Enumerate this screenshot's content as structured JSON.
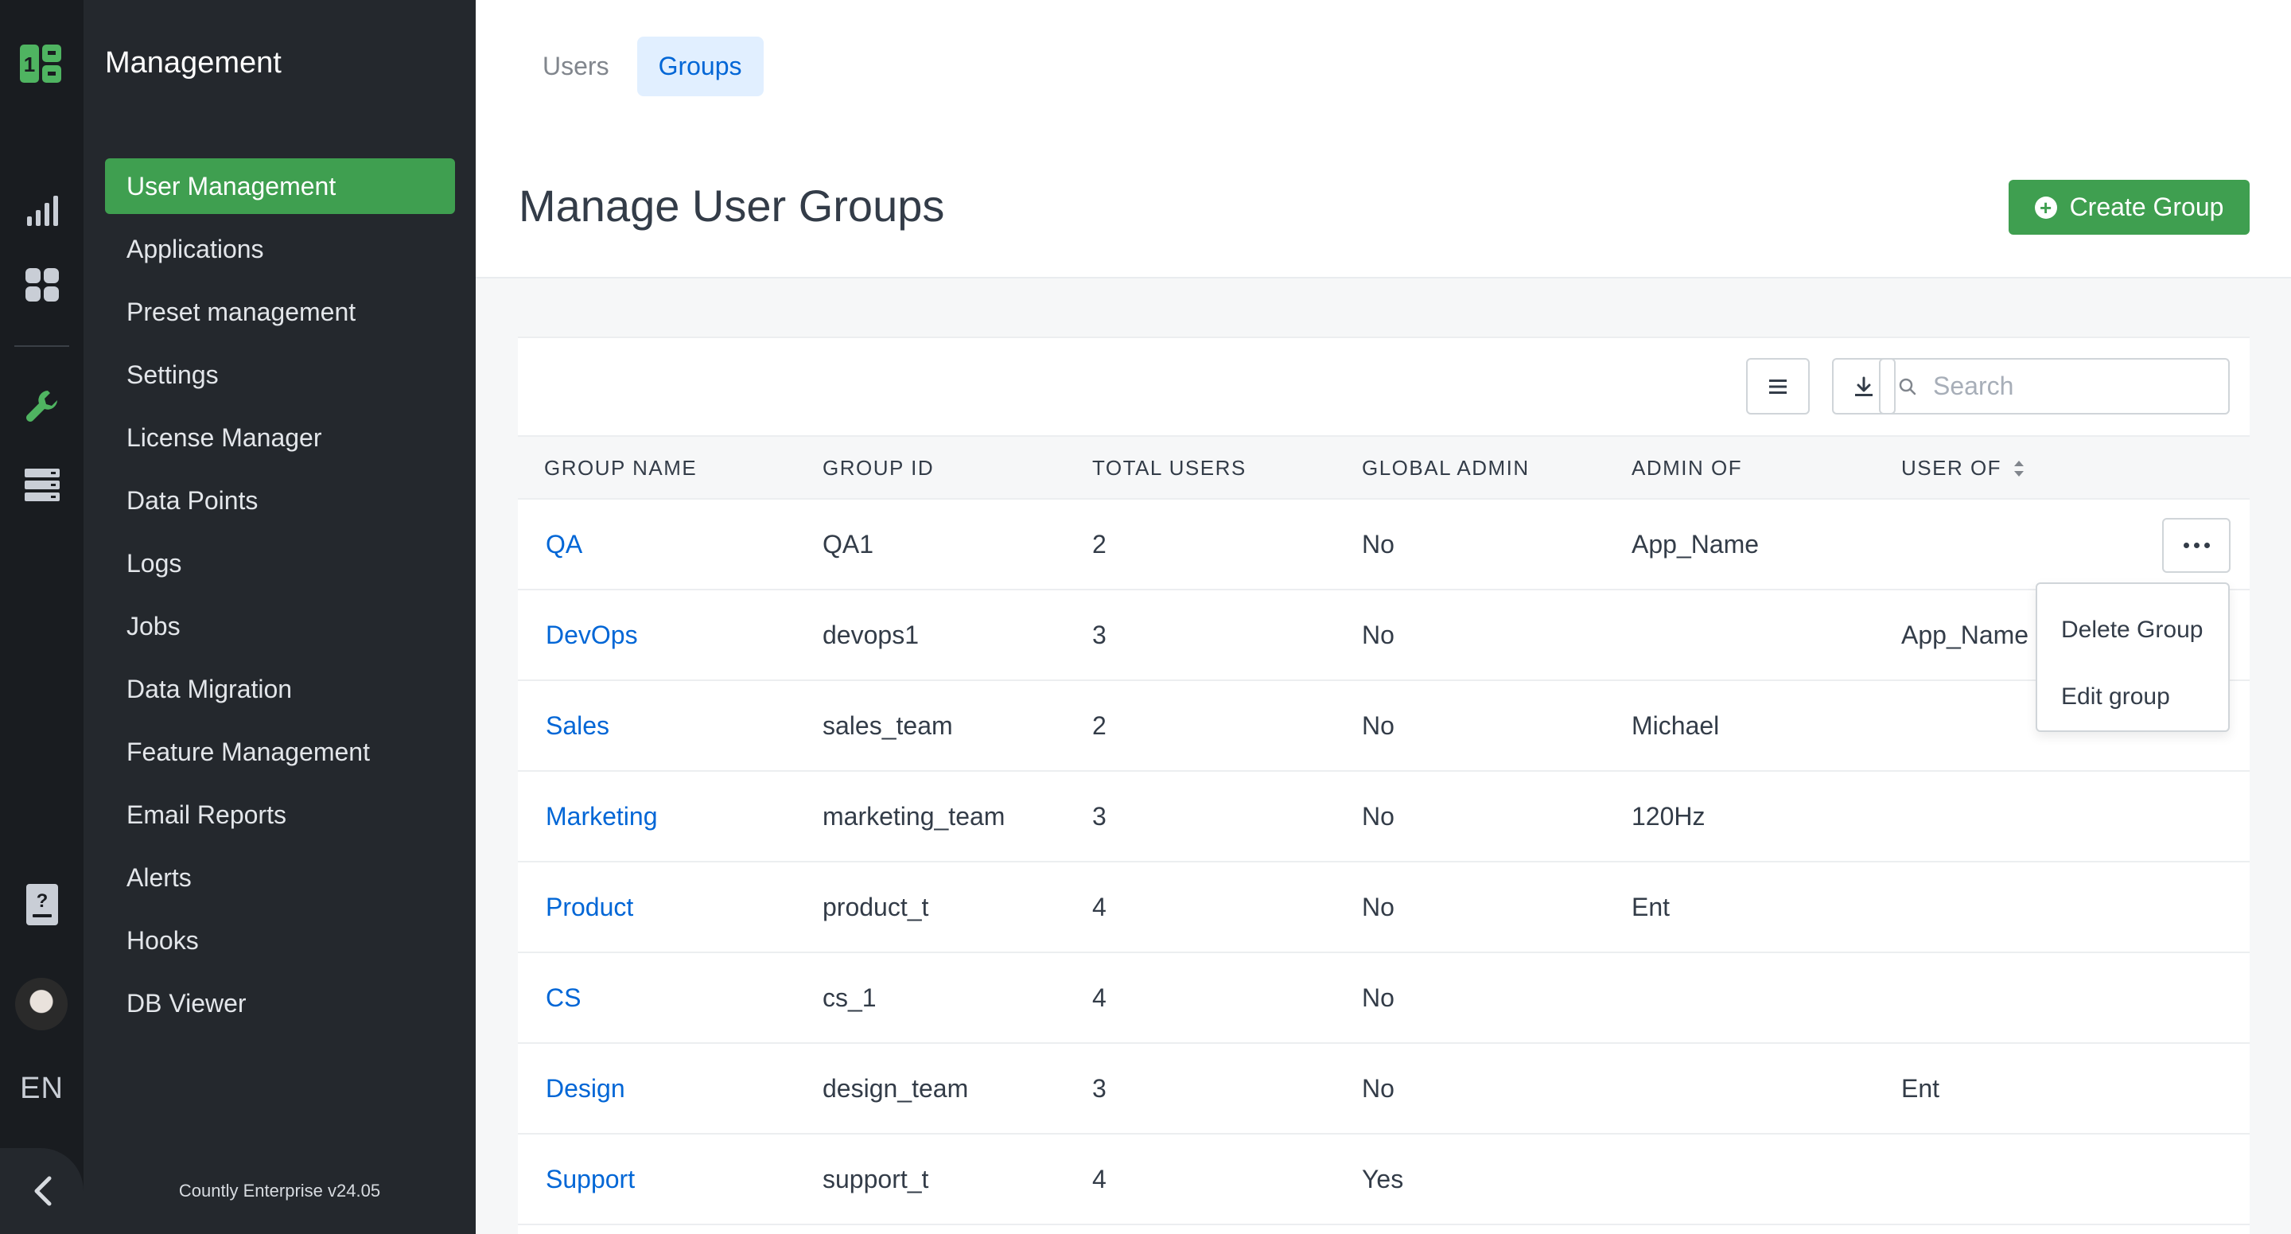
{
  "sidebar": {
    "title": "Management",
    "items": [
      {
        "label": "User Management",
        "active": true
      },
      {
        "label": "Applications"
      },
      {
        "label": "Preset management"
      },
      {
        "label": "Settings"
      },
      {
        "label": "License Manager"
      },
      {
        "label": "Data Points"
      },
      {
        "label": "Logs"
      },
      {
        "label": "Jobs"
      },
      {
        "label": "Data Migration"
      },
      {
        "label": "Feature Management"
      },
      {
        "label": "Email Reports"
      },
      {
        "label": "Alerts"
      },
      {
        "label": "Hooks"
      },
      {
        "label": "DB Viewer"
      }
    ],
    "version": "Countly Enterprise v24.05"
  },
  "rail": {
    "icons": [
      "countly-logo-icon",
      "analytics-icon",
      "dashboards-icon",
      "wrench-icon",
      "server-icon",
      "help-document-icon",
      "user-avatar",
      "collapse-chevron-icon"
    ],
    "language": "EN"
  },
  "header": {
    "tabs": [
      {
        "label": "Users",
        "active": false
      },
      {
        "label": "Groups",
        "active": true
      }
    ],
    "title": "Manage User Groups",
    "create_label": "Create Group"
  },
  "toolbar": {
    "search_placeholder": "Search"
  },
  "table": {
    "columns": [
      "GROUP NAME",
      "GROUP ID",
      "TOTAL USERS",
      "GLOBAL ADMIN",
      "ADMIN OF",
      "USER OF"
    ],
    "rows": [
      {
        "name": "QA",
        "id": "QA1",
        "total": "2",
        "global_admin": "No",
        "admin_of": "App_Name",
        "user_of": ""
      },
      {
        "name": "DevOps",
        "id": "devops1",
        "total": "3",
        "global_admin": "No",
        "admin_of": "",
        "user_of": "App_Name"
      },
      {
        "name": "Sales",
        "id": "sales_team",
        "total": "2",
        "global_admin": "No",
        "admin_of": "Michael",
        "user_of": ""
      },
      {
        "name": "Marketing",
        "id": "marketing_team",
        "total": "3",
        "global_admin": "No",
        "admin_of": "120Hz",
        "user_of": ""
      },
      {
        "name": "Product",
        "id": "product_t",
        "total": "4",
        "global_admin": "No",
        "admin_of": "Ent",
        "user_of": ""
      },
      {
        "name": "CS",
        "id": "cs_1",
        "total": "4",
        "global_admin": "No",
        "admin_of": "",
        "user_of": ""
      },
      {
        "name": "Design",
        "id": "design_team",
        "total": "3",
        "global_admin": "No",
        "admin_of": "",
        "user_of": "Ent"
      },
      {
        "name": "Support",
        "id": "support_t",
        "total": "4",
        "global_admin": "Yes",
        "admin_of": "",
        "user_of": ""
      }
    ]
  },
  "row_menu": {
    "items": [
      "Delete Group",
      "Edit group"
    ]
  },
  "colors": {
    "accent_green": "#3f9f50",
    "link_blue": "#0166d6",
    "sidebar_bg": "#24282d",
    "rail_bg": "#191c20"
  }
}
